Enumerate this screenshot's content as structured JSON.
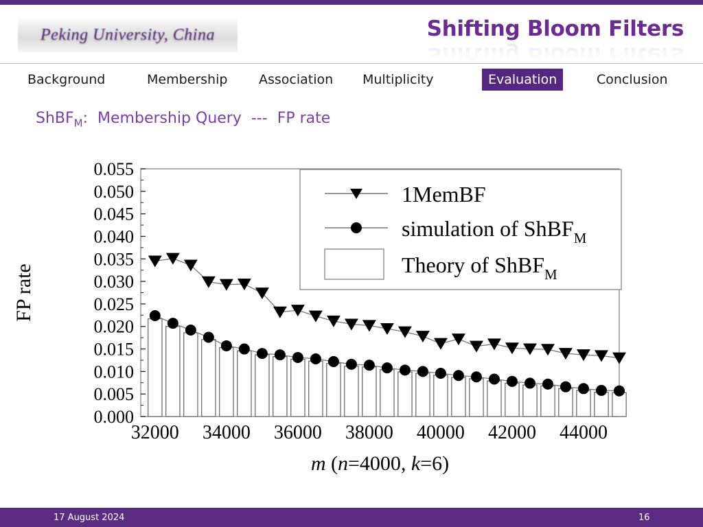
{
  "theme": {
    "accent_purple": "#5B2D82",
    "title_purple": "#6A2C91",
    "subtitle_purple": "#7A3FA5",
    "nav_active_bg": "#56277E"
  },
  "header": {
    "logo_text": "Peking University, China",
    "title": "Shifting Bloom Filters"
  },
  "nav": {
    "items": [
      {
        "label": "Background",
        "active": false,
        "x": 40
      },
      {
        "label": "Membership",
        "active": false,
        "x": 214
      },
      {
        "label": "Association",
        "active": false,
        "x": 377
      },
      {
        "label": "Multiplicity",
        "active": false,
        "x": 528
      },
      {
        "label": "Evaluation",
        "active": true,
        "x": 702
      },
      {
        "label": "Conclusion",
        "active": false,
        "x": 860
      }
    ]
  },
  "subtitle": {
    "prefix": "ShBF",
    "subscript": "M",
    "colon": ":",
    "main": "Membership Query",
    "dashes": "---",
    "tail": "FP rate"
  },
  "footer": {
    "date": "17 August 2024",
    "page_number": "16"
  },
  "chart_data": {
    "type": "bar",
    "title": "",
    "xlabel_parts": {
      "m": "m",
      "open": "(",
      "n": "n",
      "n_val": "=4000,",
      "k": "k",
      "k_val": "=6)"
    },
    "xlabel": "m (n=4000, k=6)",
    "ylabel": "FP rate",
    "xlim": [
      31600,
      45000
    ],
    "ylim": [
      0.0,
      0.055
    ],
    "x_ticks": [
      32000,
      34000,
      36000,
      38000,
      40000,
      42000,
      44000
    ],
    "x_tick_labels": [
      "32000",
      "34000",
      "36000",
      "38000",
      "40000",
      "42000",
      "44000"
    ],
    "x_minor_step": 500,
    "y_ticks": [
      0.0,
      0.005,
      0.01,
      0.015,
      0.02,
      0.025,
      0.03,
      0.035,
      0.04,
      0.045,
      0.05,
      0.055
    ],
    "y_tick_labels": [
      "0.000",
      "0.005",
      "0.010",
      "0.015",
      "0.020",
      "0.025",
      "0.030",
      "0.035",
      "0.040",
      "0.045",
      "0.050",
      "0.055"
    ],
    "grid": false,
    "legend_position": "upper-right",
    "x": [
      32000,
      32500,
      33000,
      33500,
      34000,
      34500,
      35000,
      35500,
      36000,
      36500,
      37000,
      37500,
      38000,
      38500,
      39000,
      39500,
      40000,
      40500,
      41000,
      41500,
      42000,
      42500,
      43000,
      43500,
      44000,
      44500,
      45000
    ],
    "series": [
      {
        "name": "1MemBF",
        "marker": "triangle-down",
        "style": "line+marker",
        "values": [
          0.0345,
          0.0351,
          0.0336,
          0.0299,
          0.0293,
          0.0294,
          0.0274,
          0.0232,
          0.0236,
          0.0223,
          0.0212,
          0.0205,
          0.0202,
          0.0195,
          0.0188,
          0.0178,
          0.0162,
          0.0172,
          0.0156,
          0.0161,
          0.0152,
          0.015,
          0.0149,
          0.014,
          0.0137,
          0.0135,
          0.013
        ]
      },
      {
        "name": "simulation of ShBF",
        "name_subscript": "M",
        "marker": "circle",
        "style": "line+marker",
        "values": [
          0.0224,
          0.0207,
          0.0192,
          0.0176,
          0.0157,
          0.015,
          0.014,
          0.0137,
          0.0131,
          0.0128,
          0.0122,
          0.0116,
          0.0114,
          0.0108,
          0.0103,
          0.01,
          0.0096,
          0.0091,
          0.0088,
          0.0083,
          0.0078,
          0.0074,
          0.0072,
          0.0066,
          0.0062,
          0.0058,
          0.0057
        ]
      },
      {
        "name": "Theory of ShBF",
        "name_subscript": "M",
        "marker": "bar",
        "style": "bar",
        "values": [
          0.0217,
          0.02,
          0.0186,
          0.0171,
          0.0153,
          0.0146,
          0.0137,
          0.0133,
          0.0127,
          0.0123,
          0.0118,
          0.0112,
          0.011,
          0.0104,
          0.0099,
          0.0096,
          0.0092,
          0.0087,
          0.0084,
          0.0079,
          0.0074,
          0.007,
          0.0068,
          0.0062,
          0.0058,
          0.0054,
          0.0053
        ]
      }
    ],
    "legend": [
      {
        "label": "1MemBF",
        "subscript": "",
        "marker": "triangle-down"
      },
      {
        "label": "simulation of ShBF",
        "subscript": "M",
        "marker": "circle"
      },
      {
        "label": "Theory of ShBF",
        "subscript": "M",
        "marker": "bar"
      }
    ]
  }
}
